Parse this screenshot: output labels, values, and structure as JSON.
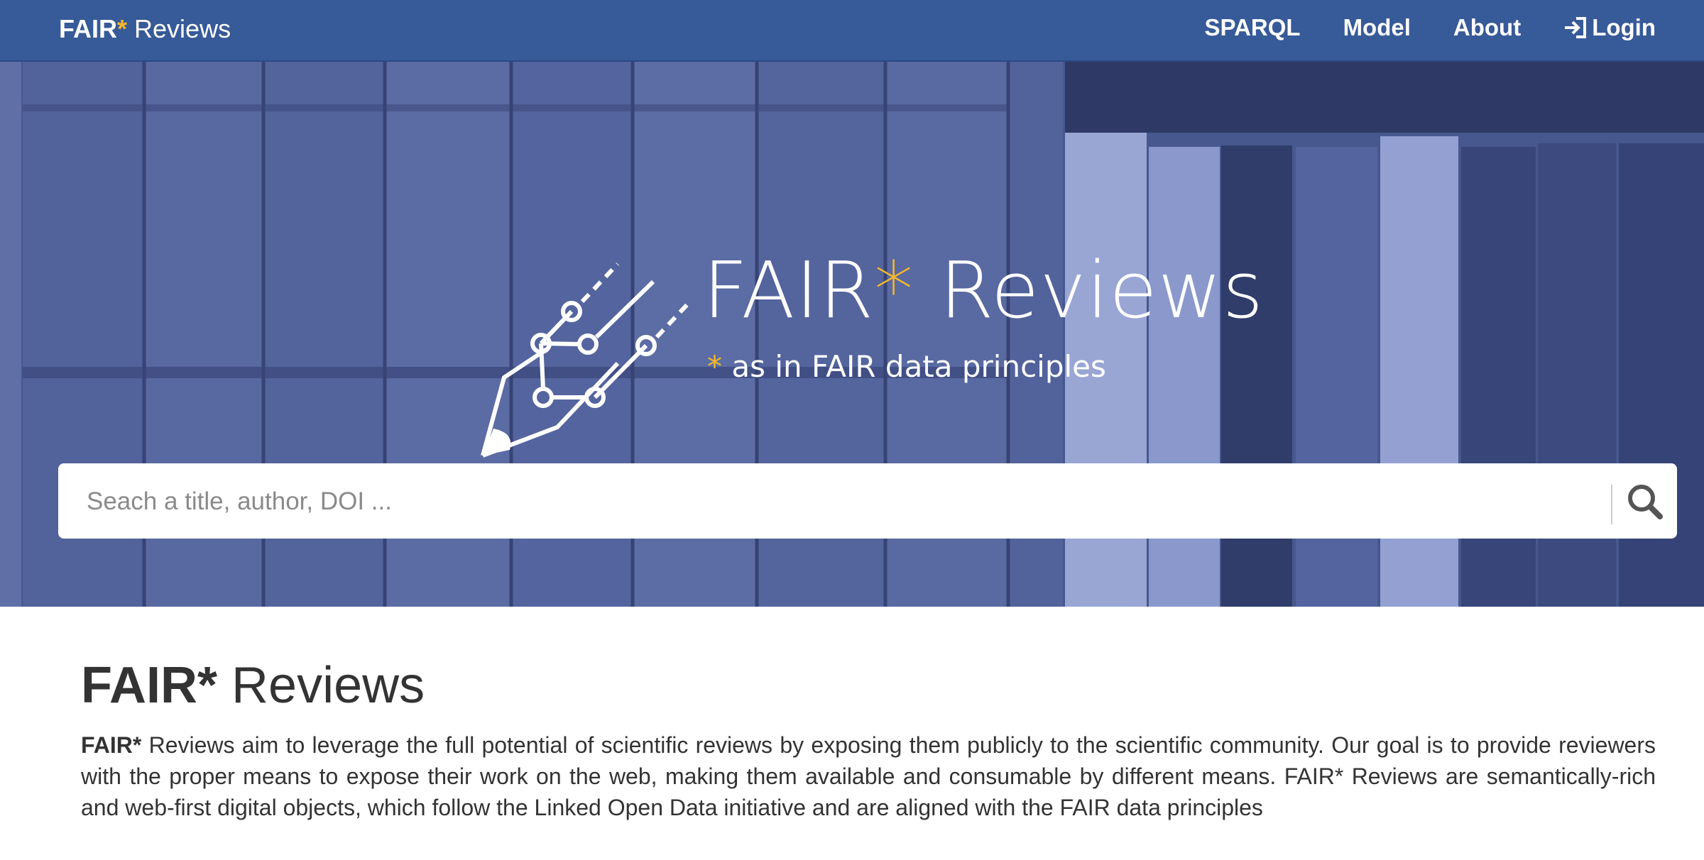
{
  "navbar": {
    "brand_bold": "FAIR",
    "brand_star": "*",
    "brand_rest": " Reviews",
    "bg_color": "#375a98",
    "links": [
      {
        "label": "SPARQL"
      },
      {
        "label": "Model"
      },
      {
        "label": "About"
      },
      {
        "label": "Login",
        "icon": "login-icon"
      }
    ]
  },
  "hero": {
    "title_main": "FAIR",
    "title_star": "*",
    "title_rest": " Reviews",
    "subtitle_star": "*",
    "subtitle_rest": " as in FAIR data principles",
    "logo_icon": "pen-network-logo",
    "accent_color": "#f5b72a"
  },
  "search": {
    "placeholder": "Seach a title, author, DOI ...",
    "value": "",
    "icon": "search-icon"
  },
  "content": {
    "title_bold": "FAIR*",
    "title_rest": " Reviews",
    "intro_bold": "FAIR*",
    "intro_text": " Reviews aim to leverage the full potential of scientific reviews by exposing them publicly to the scientific community. Our goal is to provide reviewers with the proper means to expose their work on the web, making them available and consumable by different means. FAIR* Reviews are semantically-rich and web-first digital objects, which follow the Linked Open Data initiative and are aligned with the FAIR data principles"
  }
}
